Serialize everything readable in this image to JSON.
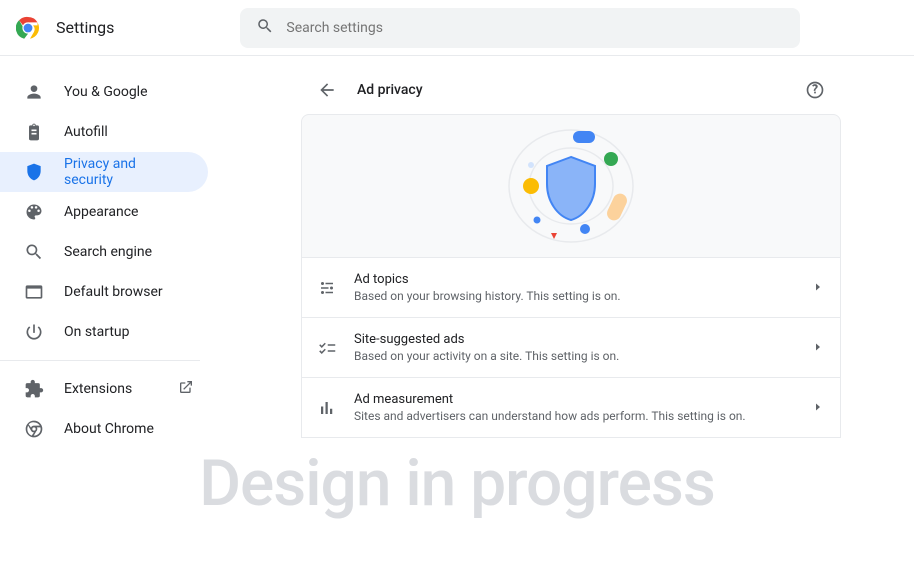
{
  "app_title": "Settings",
  "search": {
    "placeholder": "Search settings"
  },
  "sidebar": {
    "items": [
      {
        "label": "You & Google"
      },
      {
        "label": "Autofill"
      },
      {
        "label": "Privacy and security"
      },
      {
        "label": "Appearance"
      },
      {
        "label": "Search engine"
      },
      {
        "label": "Default browser"
      },
      {
        "label": "On startup"
      }
    ],
    "extras": [
      {
        "label": "Extensions"
      },
      {
        "label": "About Chrome"
      }
    ]
  },
  "page": {
    "title": "Ad privacy",
    "rows": [
      {
        "title": "Ad topics",
        "sub": "Based on your browsing history. This setting is on."
      },
      {
        "title": "Site-suggested ads",
        "sub": "Based on your activity on a site. This setting is on."
      },
      {
        "title": "Ad measurement",
        "sub": "Sites and advertisers can understand how ads perform. This setting is on."
      }
    ]
  },
  "watermark": "Design in progress"
}
